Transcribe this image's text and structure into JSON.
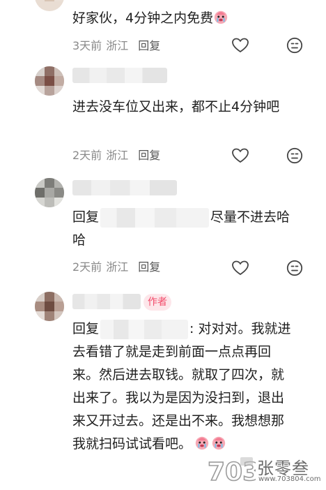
{
  "comments": [
    {
      "text": "好家伙，4分钟之内免费",
      "time": "3天前",
      "location": "浙江",
      "reply_label": "回复"
    },
    {
      "text": "进去没车位又出来，都不止4分钟吧",
      "time": "2天前",
      "location": "浙江",
      "reply_label": "回复"
    },
    {
      "prefix": "回复",
      "text": "尽量不进去哈哈",
      "time": "2天前",
      "location": "浙江",
      "reply_label": "回复"
    },
    {
      "author_tag": "作者",
      "prefix": "回复",
      "text": ": 对对对。我就进去看错了就是走到前面一点点再回来。然后进去取钱。就取了四次，就出来了。我以为是因为没扫到，退出来又开过去。还是出不来。我想想那我就扫码试试看吧。"
    }
  ],
  "watermark": {
    "logo_text": "703",
    "title": "张零叁",
    "url": "www.703804.com"
  },
  "icons": {
    "like": "heart-outline-icon",
    "dislike": "meh-face-icon",
    "emoji": "crying-face-emoji"
  },
  "colors": {
    "text": "#1f1f1f",
    "meta": "#8a8a8a",
    "author_tag_bg": "#fde6ea",
    "author_tag_text": "#f24b6a"
  }
}
